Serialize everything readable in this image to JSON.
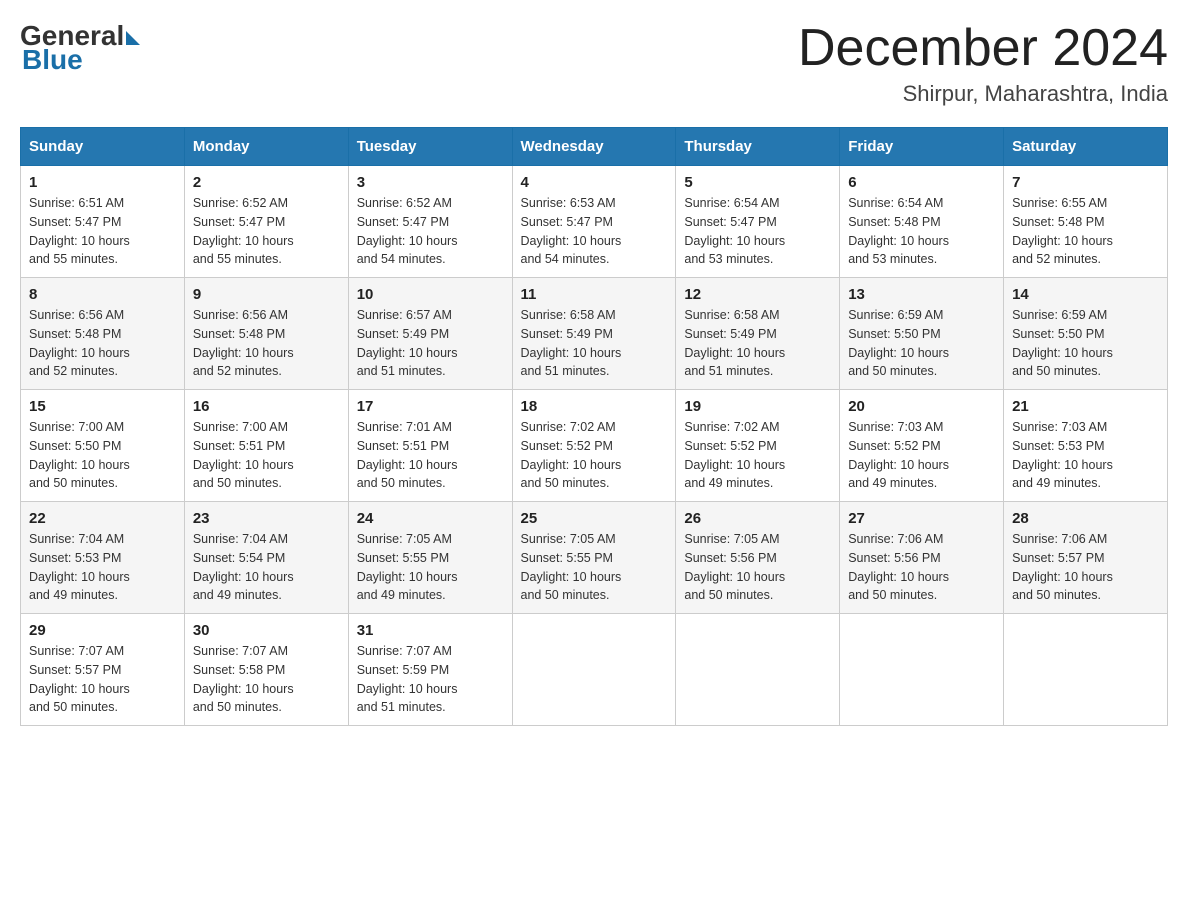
{
  "logo": {
    "general": "General",
    "blue": "Blue"
  },
  "title": "December 2024",
  "location": "Shirpur, Maharashtra, India",
  "days_of_week": [
    "Sunday",
    "Monday",
    "Tuesday",
    "Wednesday",
    "Thursday",
    "Friday",
    "Saturday"
  ],
  "weeks": [
    [
      {
        "day": "1",
        "sunrise": "6:51 AM",
        "sunset": "5:47 PM",
        "daylight": "10 hours and 55 minutes."
      },
      {
        "day": "2",
        "sunrise": "6:52 AM",
        "sunset": "5:47 PM",
        "daylight": "10 hours and 55 minutes."
      },
      {
        "day": "3",
        "sunrise": "6:52 AM",
        "sunset": "5:47 PM",
        "daylight": "10 hours and 54 minutes."
      },
      {
        "day": "4",
        "sunrise": "6:53 AM",
        "sunset": "5:47 PM",
        "daylight": "10 hours and 54 minutes."
      },
      {
        "day": "5",
        "sunrise": "6:54 AM",
        "sunset": "5:47 PM",
        "daylight": "10 hours and 53 minutes."
      },
      {
        "day": "6",
        "sunrise": "6:54 AM",
        "sunset": "5:48 PM",
        "daylight": "10 hours and 53 minutes."
      },
      {
        "day": "7",
        "sunrise": "6:55 AM",
        "sunset": "5:48 PM",
        "daylight": "10 hours and 52 minutes."
      }
    ],
    [
      {
        "day": "8",
        "sunrise": "6:56 AM",
        "sunset": "5:48 PM",
        "daylight": "10 hours and 52 minutes."
      },
      {
        "day": "9",
        "sunrise": "6:56 AM",
        "sunset": "5:48 PM",
        "daylight": "10 hours and 52 minutes."
      },
      {
        "day": "10",
        "sunrise": "6:57 AM",
        "sunset": "5:49 PM",
        "daylight": "10 hours and 51 minutes."
      },
      {
        "day": "11",
        "sunrise": "6:58 AM",
        "sunset": "5:49 PM",
        "daylight": "10 hours and 51 minutes."
      },
      {
        "day": "12",
        "sunrise": "6:58 AM",
        "sunset": "5:49 PM",
        "daylight": "10 hours and 51 minutes."
      },
      {
        "day": "13",
        "sunrise": "6:59 AM",
        "sunset": "5:50 PM",
        "daylight": "10 hours and 50 minutes."
      },
      {
        "day": "14",
        "sunrise": "6:59 AM",
        "sunset": "5:50 PM",
        "daylight": "10 hours and 50 minutes."
      }
    ],
    [
      {
        "day": "15",
        "sunrise": "7:00 AM",
        "sunset": "5:50 PM",
        "daylight": "10 hours and 50 minutes."
      },
      {
        "day": "16",
        "sunrise": "7:00 AM",
        "sunset": "5:51 PM",
        "daylight": "10 hours and 50 minutes."
      },
      {
        "day": "17",
        "sunrise": "7:01 AM",
        "sunset": "5:51 PM",
        "daylight": "10 hours and 50 minutes."
      },
      {
        "day": "18",
        "sunrise": "7:02 AM",
        "sunset": "5:52 PM",
        "daylight": "10 hours and 50 minutes."
      },
      {
        "day": "19",
        "sunrise": "7:02 AM",
        "sunset": "5:52 PM",
        "daylight": "10 hours and 49 minutes."
      },
      {
        "day": "20",
        "sunrise": "7:03 AM",
        "sunset": "5:52 PM",
        "daylight": "10 hours and 49 minutes."
      },
      {
        "day": "21",
        "sunrise": "7:03 AM",
        "sunset": "5:53 PM",
        "daylight": "10 hours and 49 minutes."
      }
    ],
    [
      {
        "day": "22",
        "sunrise": "7:04 AM",
        "sunset": "5:53 PM",
        "daylight": "10 hours and 49 minutes."
      },
      {
        "day": "23",
        "sunrise": "7:04 AM",
        "sunset": "5:54 PM",
        "daylight": "10 hours and 49 minutes."
      },
      {
        "day": "24",
        "sunrise": "7:05 AM",
        "sunset": "5:55 PM",
        "daylight": "10 hours and 49 minutes."
      },
      {
        "day": "25",
        "sunrise": "7:05 AM",
        "sunset": "5:55 PM",
        "daylight": "10 hours and 50 minutes."
      },
      {
        "day": "26",
        "sunrise": "7:05 AM",
        "sunset": "5:56 PM",
        "daylight": "10 hours and 50 minutes."
      },
      {
        "day": "27",
        "sunrise": "7:06 AM",
        "sunset": "5:56 PM",
        "daylight": "10 hours and 50 minutes."
      },
      {
        "day": "28",
        "sunrise": "7:06 AM",
        "sunset": "5:57 PM",
        "daylight": "10 hours and 50 minutes."
      }
    ],
    [
      {
        "day": "29",
        "sunrise": "7:07 AM",
        "sunset": "5:57 PM",
        "daylight": "10 hours and 50 minutes."
      },
      {
        "day": "30",
        "sunrise": "7:07 AM",
        "sunset": "5:58 PM",
        "daylight": "10 hours and 50 minutes."
      },
      {
        "day": "31",
        "sunrise": "7:07 AM",
        "sunset": "5:59 PM",
        "daylight": "10 hours and 51 minutes."
      },
      null,
      null,
      null,
      null
    ]
  ],
  "labels": {
    "sunrise": "Sunrise:",
    "sunset": "Sunset:",
    "daylight": "Daylight:"
  }
}
